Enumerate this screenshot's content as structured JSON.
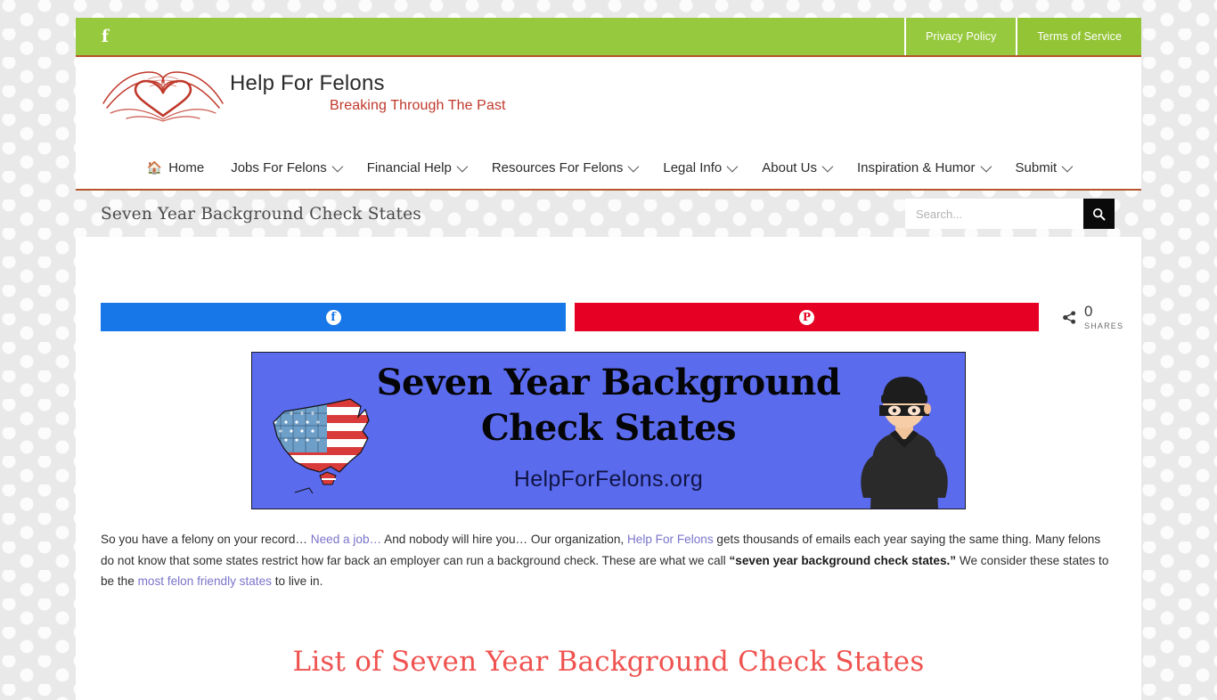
{
  "topbar": {
    "facebook_icon": "facebook-icon",
    "links": [
      {
        "label": "Privacy Policy"
      },
      {
        "label": "Terms of Service"
      }
    ],
    "bg_color": "#96c93d"
  },
  "header": {
    "logo_title": "Help For Felons",
    "logo_tagline": "Breaking Through The Past",
    "logo_icon": "hands-heart-book-logo",
    "accent_color": "#c0392b"
  },
  "nav": {
    "items": [
      {
        "label": "Home",
        "icon": "home-icon",
        "caret": false
      },
      {
        "label": "Jobs For Felons",
        "caret": true
      },
      {
        "label": "Financial Help",
        "caret": true
      },
      {
        "label": "Resources For Felons",
        "caret": true
      },
      {
        "label": "Legal Info",
        "caret": true
      },
      {
        "label": "About Us",
        "caret": true
      },
      {
        "label": "Inspiration & Humor",
        "caret": true
      },
      {
        "label": "Submit",
        "caret": true
      }
    ]
  },
  "titlebar": {
    "title": "Seven Year Background Check States"
  },
  "search": {
    "placeholder": "Search...",
    "value": "",
    "icon": "search-icon"
  },
  "share": {
    "facebook_label": "",
    "pinterest_label": "",
    "facebook_icon": "facebook-icon",
    "pinterest_icon": "pinterest-icon",
    "network_icon": "share-network-icon",
    "count": "0",
    "count_label": "SHARES",
    "facebook_color": "#1877e8",
    "pinterest_color": "#e60023"
  },
  "featured_image": {
    "headline_line1": "Seven Year Background",
    "headline_line2": "Check States",
    "site": "HelpForFelons.org",
    "background_color": "#5b6bee",
    "map_icon": "usa-flag-map-illustration",
    "thief_icon": "masked-burglar-illustration"
  },
  "article": {
    "paragraph": {
      "t1": "So you have a felony on your record… ",
      "link1": "Need a job…",
      "t2": " And nobody will hire you… Our organization, ",
      "link2": "Help For Felons",
      "t3": " gets thousands of emails each year saying the same thing. Many felons do not know that some states restrict how far back an employer can run a background check. These are what we call ",
      "bold1": "“seven year background check states.”",
      "t4": " We consider these states to be the ",
      "link3": "most felon friendly states",
      "t5": " to live in."
    },
    "section_heading": "List of Seven Year Background Check States",
    "heading_color": "#ef5350"
  }
}
